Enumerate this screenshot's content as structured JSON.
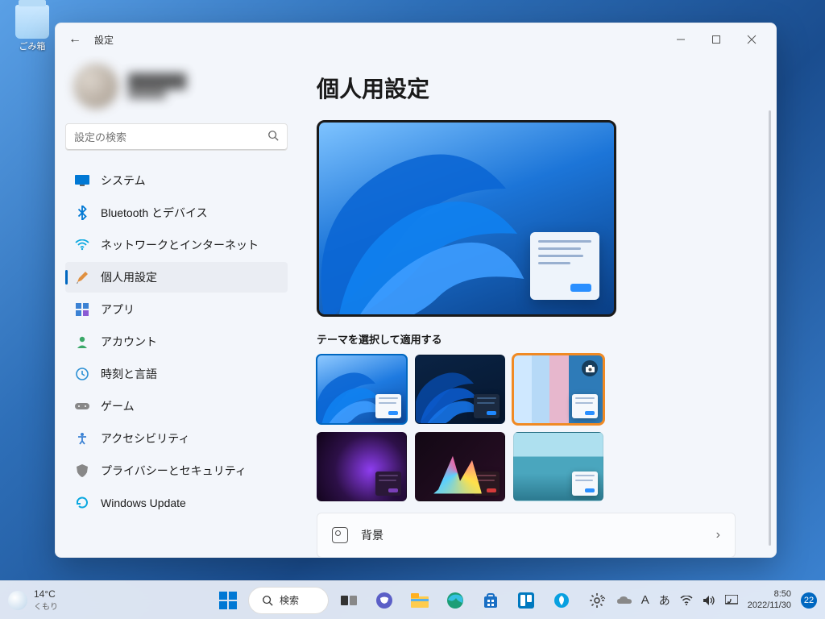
{
  "desktop": {
    "recycle_bin": "ごみ箱"
  },
  "window": {
    "title": "設定",
    "user": {
      "name": "██████",
      "email": "██████"
    },
    "search_placeholder": "設定の検索",
    "nav": [
      {
        "id": "system",
        "label": "システム"
      },
      {
        "id": "bluetooth",
        "label": "Bluetooth とデバイス"
      },
      {
        "id": "network",
        "label": "ネットワークとインターネット"
      },
      {
        "id": "personalization",
        "label": "個人用設定",
        "active": true
      },
      {
        "id": "apps",
        "label": "アプリ"
      },
      {
        "id": "accounts",
        "label": "アカウント"
      },
      {
        "id": "time",
        "label": "時刻と言語"
      },
      {
        "id": "gaming",
        "label": "ゲーム"
      },
      {
        "id": "accessibility",
        "label": "アクセシビリティ"
      },
      {
        "id": "privacy",
        "label": "プライバシーとセキュリティ"
      },
      {
        "id": "update",
        "label": "Windows Update"
      }
    ],
    "content": {
      "heading": "個人用設定",
      "theme_label": "テーマを選択して適用する",
      "background_label": "背景"
    }
  },
  "taskbar": {
    "weather": {
      "temp": "14°C",
      "cond": "くもり"
    },
    "search": "検索",
    "clock": {
      "time": "8:50",
      "date": "2022/11/30"
    },
    "notif_count": "22"
  }
}
